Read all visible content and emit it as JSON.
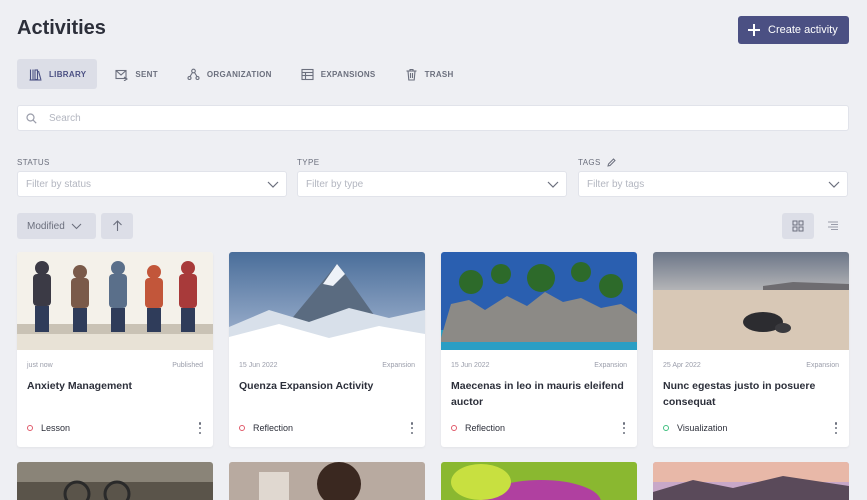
{
  "page": {
    "title": "Activities",
    "create_button_label": "Create activity"
  },
  "tabs": [
    {
      "label": "LIBRARY",
      "icon": "library-icon",
      "active": true
    },
    {
      "label": "SENT",
      "icon": "sent-icon",
      "active": false
    },
    {
      "label": "ORGANIZATION",
      "icon": "organization-icon",
      "active": false
    },
    {
      "label": "EXPANSIONS",
      "icon": "expansions-icon",
      "active": false
    },
    {
      "label": "TRASH",
      "icon": "trash-icon",
      "active": false
    }
  ],
  "search": {
    "placeholder": "Search",
    "value": ""
  },
  "filters": {
    "status": {
      "label": "STATUS",
      "placeholder": "Filter by status"
    },
    "type": {
      "label": "TYPE",
      "placeholder": "Filter by type"
    },
    "tags": {
      "label": "TAGS",
      "placeholder": "Filter by tags"
    }
  },
  "sort": {
    "label": "Modified",
    "direction": "ascending"
  },
  "view": {
    "mode": "grid"
  },
  "colors": {
    "accent": "#4b5083",
    "background": "#eeeff3",
    "lesson_dot": "#e05a6a",
    "reflection_dot": "#e05a6a",
    "visualization_dot": "#3fbf7f"
  },
  "cards": [
    {
      "date": "just now",
      "status": "Published",
      "name": "Anxiety Management",
      "type": "Lesson",
      "image": "people-sitting-illustration"
    },
    {
      "date": "15 Jun 2022",
      "status": "Expansion",
      "name": "Quenza Expansion Activity",
      "type": "Reflection",
      "image": "mountain-peak"
    },
    {
      "date": "15 Jun 2022",
      "status": "Expansion",
      "name": "Maecenas in leo in mauris eleifend auctor",
      "type": "Reflection",
      "image": "tropical-island-rocks"
    },
    {
      "date": "25 Apr 2022",
      "status": "Expansion",
      "name": "Nunc egestas justo in posuere consequat",
      "type": "Visualization",
      "image": "beach-rock-sunset"
    }
  ],
  "next_row_images": [
    "glasses-on-table",
    "woman-curly-hair",
    "green-plant-closeup",
    "purple-sunset-landscape"
  ]
}
